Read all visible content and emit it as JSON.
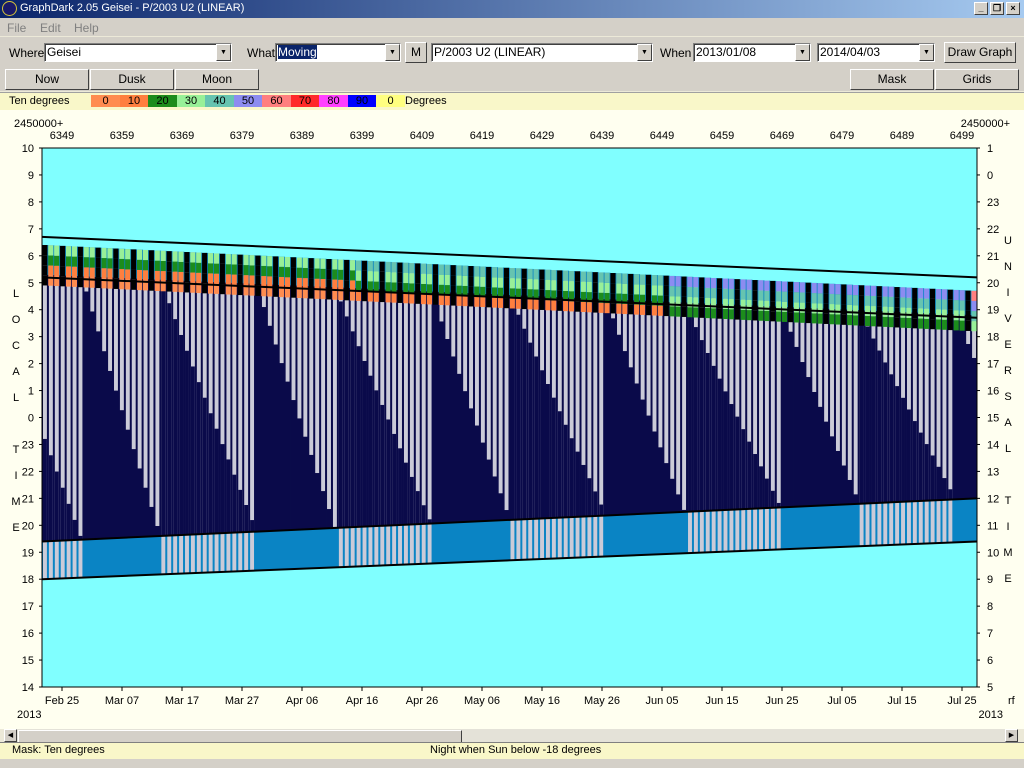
{
  "window": {
    "title": "GraphDark 2.05  Geisei  -  P/2003 U2 (LINEAR)",
    "min": "_",
    "restore": "❐",
    "close": "×"
  },
  "menu": [
    "File",
    "Edit",
    "Help"
  ],
  "toolbar": {
    "where_label": "Where",
    "where_value": "Geisei",
    "what_label": "What",
    "what_value": "Moving",
    "m_button": "M",
    "object_value": "P/2003 U2 (LINEAR)",
    "when_label": "When",
    "date_start": "2013/01/08",
    "date_end": "2014/04/03",
    "draw_button": "Draw Graph"
  },
  "nav": {
    "now": "Now",
    "dusk": "Dusk",
    "moon": "Moon",
    "mask": "Mask",
    "grids": "Grids"
  },
  "legend": {
    "title": "Ten degrees",
    "unit": "Degrees",
    "items": [
      {
        "label": "0",
        "color": "#ff8c50"
      },
      {
        "label": "10",
        "color": "#ff7f3f"
      },
      {
        "label": "20",
        "color": "#1c8c1c"
      },
      {
        "label": "30",
        "color": "#98f098"
      },
      {
        "label": "40",
        "color": "#66c4b0"
      },
      {
        "label": "50",
        "color": "#8c8cf0"
      },
      {
        "label": "60",
        "color": "#ff7f7f"
      },
      {
        "label": "70",
        "color": "#ff2a2a"
      },
      {
        "label": "80",
        "color": "#ff40ff"
      },
      {
        "label": "90",
        "color": "#0000ff"
      },
      {
        "label": "0",
        "color": "#ffff80"
      }
    ]
  },
  "chart_data": {
    "type": "heatmap",
    "jd_prefix": "2450000+",
    "jd_ticks": [
      "6349",
      "6359",
      "6369",
      "6379",
      "6389",
      "6399",
      "6409",
      "6419",
      "6429",
      "6439",
      "6449",
      "6459",
      "6469",
      "6479",
      "6489",
      "6499"
    ],
    "date_ticks": [
      "Feb 25",
      "Mar 07",
      "Mar 17",
      "Mar 27",
      "Apr 06",
      "Apr 16",
      "Apr 26",
      "May 06",
      "May 16",
      "May 26",
      "Jun 05",
      "Jun 15",
      "Jun 25",
      "Jul 05",
      "Jul 15",
      "Jul 25"
    ],
    "year_left": "2013",
    "year_right": "2013",
    "corner_label": "rf",
    "left_axis_ticks": [
      "10",
      "9",
      "8",
      "7",
      "6",
      "5",
      "4",
      "3",
      "2",
      "1",
      "0",
      "23",
      "22",
      "21",
      "20",
      "19",
      "18",
      "17",
      "16",
      "15",
      "14"
    ],
    "right_axis_ticks": [
      "1",
      "0",
      "23",
      "22",
      "21",
      "20",
      "19",
      "18",
      "17",
      "16",
      "15",
      "14",
      "13",
      "12",
      "11",
      "10",
      "9",
      "8",
      "7",
      "6",
      "5"
    ],
    "left_axis_title": [
      "L",
      "O",
      "C",
      "A",
      "L",
      "",
      "T",
      "I",
      "M",
      "E"
    ],
    "right_axis_title_top": [
      "U",
      "N",
      "I",
      "V",
      "E",
      "R",
      "S",
      "A",
      "L"
    ],
    "right_axis_title_bottom": [
      "T",
      "I",
      "M",
      "E"
    ],
    "local_time_range": [
      14,
      34
    ],
    "days": 158,
    "sunset_hour": [
      18.0,
      19.4
    ],
    "sunrise_hour": [
      30.4,
      28.7
    ],
    "dark_start_hour": [
      19.4,
      21.0
    ],
    "dark_end_hour": [
      29.3,
      27.8
    ],
    "object_set_hour": [
      30.7,
      29.2
    ],
    "moon_cycle_days": 29.53,
    "colors": {
      "sky": "#80ffff",
      "night": "#0a0a4a",
      "twilight": "#0a84c4",
      "moon": "#cbcbd8",
      "edge": "#000000"
    }
  },
  "status": {
    "left": "Mask:  Ten degrees",
    "center": "Night when Sun below -18 degrees"
  }
}
